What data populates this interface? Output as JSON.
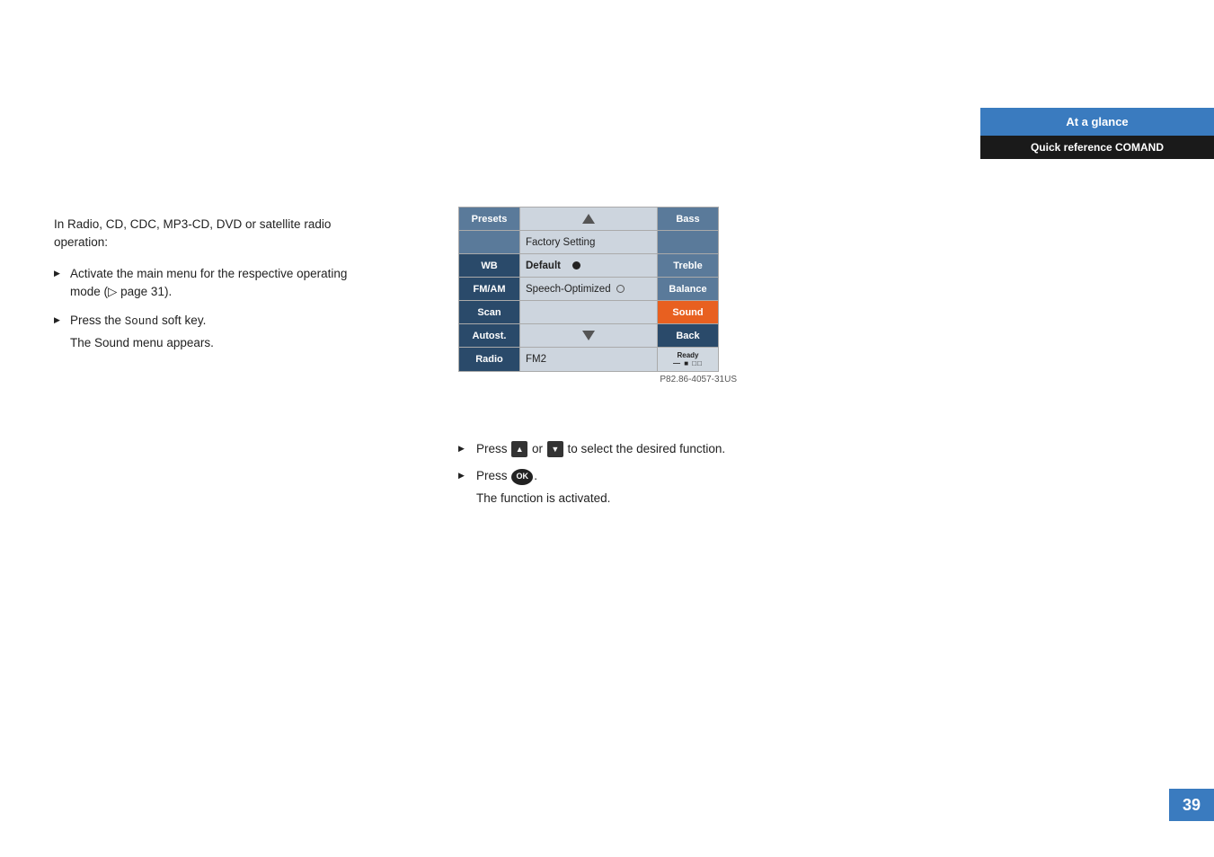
{
  "header": {
    "tab_top": "At a glance",
    "tab_bottom": "Quick reference COMAND"
  },
  "page_number": "39",
  "left": {
    "intro": "In Radio, CD, CDC, MP3-CD, DVD or satellite radio operation:",
    "bullets": [
      {
        "text": "Activate the main menu for the respective operating mode (▷ page 31)."
      },
      {
        "text": "Press the Sound soft key.",
        "sub": "The Sound menu appears."
      }
    ]
  },
  "screen": {
    "rows": [
      {
        "left": "Presets",
        "middle_top": "△",
        "right": "Bass"
      },
      {
        "left": "",
        "middle": "Factory Setting",
        "right": ""
      },
      {
        "left": "WB",
        "middle": "Default",
        "radio": "filled",
        "right": "Treble"
      },
      {
        "left": "FM/AM",
        "middle": "Speech-Optimized",
        "radio": "empty",
        "right": "Balance"
      },
      {
        "left": "Scan",
        "middle": "",
        "right": "Sound"
      },
      {
        "left": "Autost.",
        "middle_bottom": "▽",
        "right": "Back"
      },
      {
        "left": "Radio",
        "middle": "FM2",
        "right_ready": true
      }
    ],
    "image_ref": "P82.86-4057-31US"
  },
  "instructions": [
    {
      "text": "Press ▲ or ▼ to select the desired function."
    },
    {
      "text": "Press OK.",
      "sub": "The function is activated."
    }
  ]
}
